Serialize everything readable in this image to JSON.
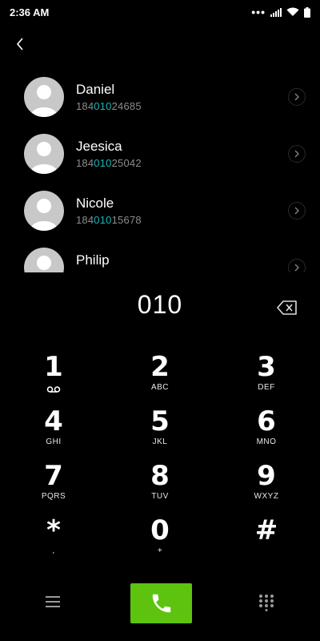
{
  "status": {
    "time": "2:36 AM",
    "signal_dots": "•••"
  },
  "contacts": [
    {
      "name": "Daniel",
      "number_pre": "184",
      "number_match": "010",
      "number_post": "24685"
    },
    {
      "name": "Jeesica",
      "number_pre": "184",
      "number_match": "010",
      "number_post": "25042"
    },
    {
      "name": "Nicole",
      "number_pre": "184",
      "number_match": "010",
      "number_post": "15678"
    },
    {
      "name": "Philip",
      "number_pre": "",
      "number_match": "",
      "number_post": ""
    }
  ],
  "dialer": {
    "entry": "010"
  },
  "keys": [
    {
      "digit": "1",
      "letters": ""
    },
    {
      "digit": "2",
      "letters": "ABC"
    },
    {
      "digit": "3",
      "letters": "DEF"
    },
    {
      "digit": "4",
      "letters": "GHI"
    },
    {
      "digit": "5",
      "letters": "JKL"
    },
    {
      "digit": "6",
      "letters": "MNO"
    },
    {
      "digit": "7",
      "letters": "PQRS"
    },
    {
      "digit": "8",
      "letters": "TUV"
    },
    {
      "digit": "9",
      "letters": "WXYZ"
    },
    {
      "digit": "*",
      "letters": ","
    },
    {
      "digit": "0",
      "letters": "+"
    },
    {
      "digit": "#",
      "letters": ""
    }
  ],
  "colors": {
    "accent": "#18b6b6",
    "call": "#5ec30e"
  },
  "icons": {
    "back": "chevron-left-icon",
    "backspace": "backspace-icon",
    "voicemail": "voicemail-icon",
    "menu": "menu-icon",
    "call": "phone-icon",
    "dialpad": "dialpad-icon"
  }
}
